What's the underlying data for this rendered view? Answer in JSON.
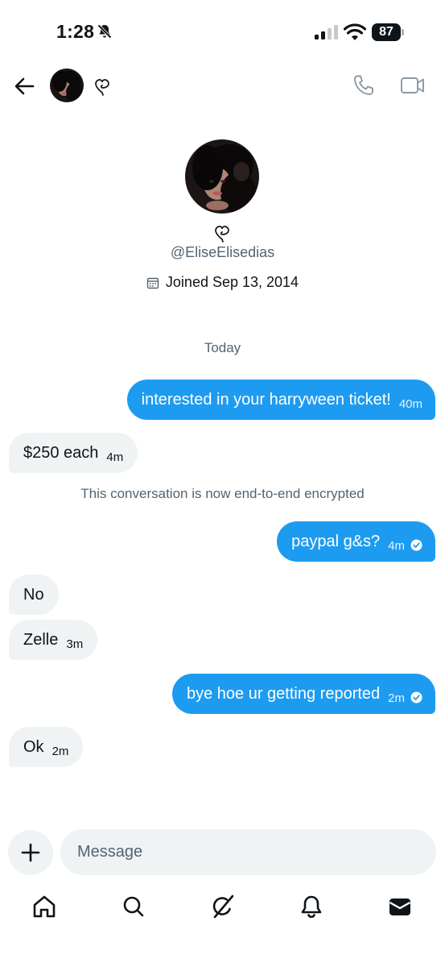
{
  "status_bar": {
    "time": "1:28",
    "battery": "87"
  },
  "header": {
    "back_icon": "arrow-left-icon",
    "call_icon": "phone-icon",
    "video_icon": "video-camera-icon"
  },
  "profile": {
    "handle": "@EliseElisedias",
    "joined": "Joined Sep 13, 2014"
  },
  "conversation": {
    "day_label": "Today",
    "encryption_notice": "This conversation is now end-to-end encrypted",
    "messages": [
      {
        "direction": "out",
        "text": "interested in your harryween ticket!",
        "time": "40m",
        "read": false
      },
      {
        "direction": "in",
        "text": "$250 each",
        "time": "4m"
      },
      {
        "direction": "out",
        "text": "paypal g&s?",
        "time": "4m",
        "read": true
      },
      {
        "direction": "in",
        "text": "No",
        "time": ""
      },
      {
        "direction": "in",
        "text": "Zelle",
        "time": "3m"
      },
      {
        "direction": "out",
        "text": "bye hoe ur getting reported",
        "time": "2m",
        "read": true
      },
      {
        "direction": "in",
        "text": "Ok",
        "time": "2m"
      }
    ]
  },
  "composer": {
    "placeholder": "Message",
    "add_icon": "plus-icon"
  },
  "bottom_nav": [
    "home-icon",
    "search-icon",
    "grok-icon",
    "bell-icon",
    "messages-icon"
  ],
  "colors": {
    "accent": "#1d9bf0",
    "incoming_bubble": "#eff3f4",
    "secondary_text": "#536471"
  }
}
